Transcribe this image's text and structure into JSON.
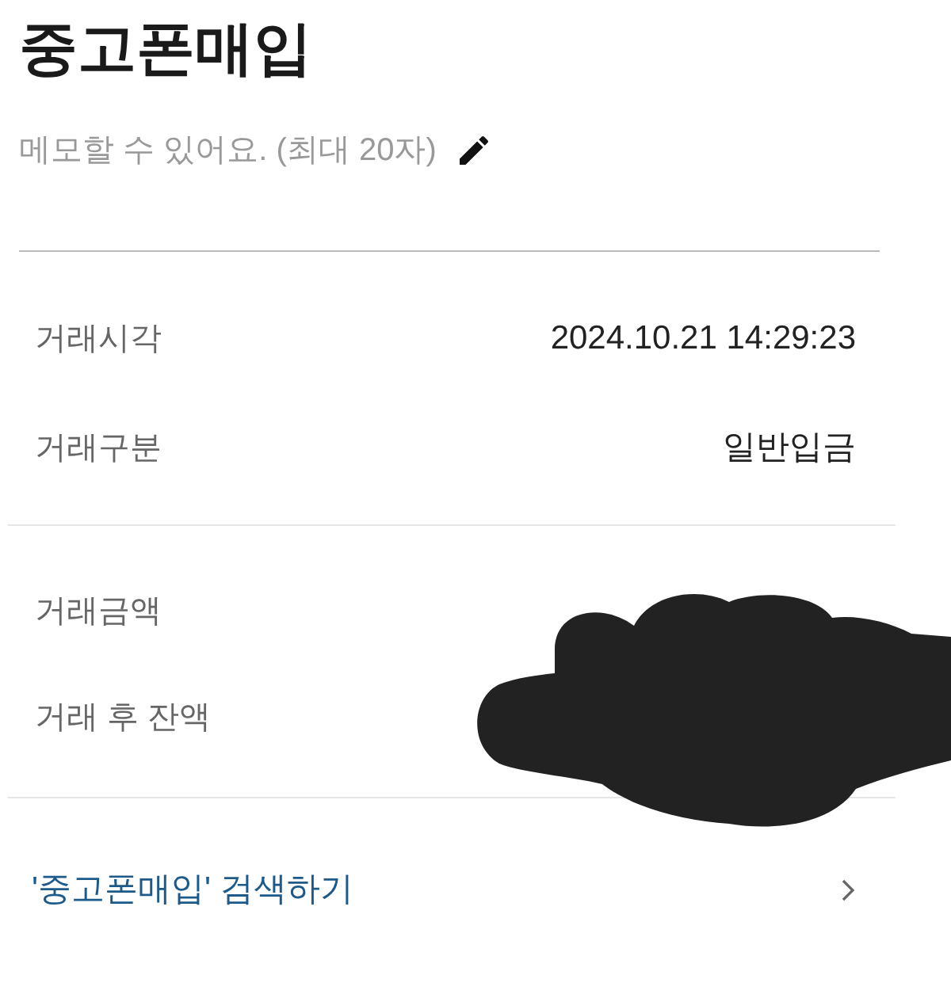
{
  "title": "중고폰매입",
  "memo": {
    "placeholder": "메모할 수 있어요. (최대 20자)"
  },
  "details": [
    {
      "label": "거래시각",
      "value": "2024.10.21 14:29:23"
    },
    {
      "label": "거래구분",
      "value": "일반입금"
    }
  ],
  "amounts": [
    {
      "label": "거래금액"
    },
    {
      "label": "거래 후 잔액"
    }
  ],
  "search_link": "'중고폰매입' 검색하기"
}
